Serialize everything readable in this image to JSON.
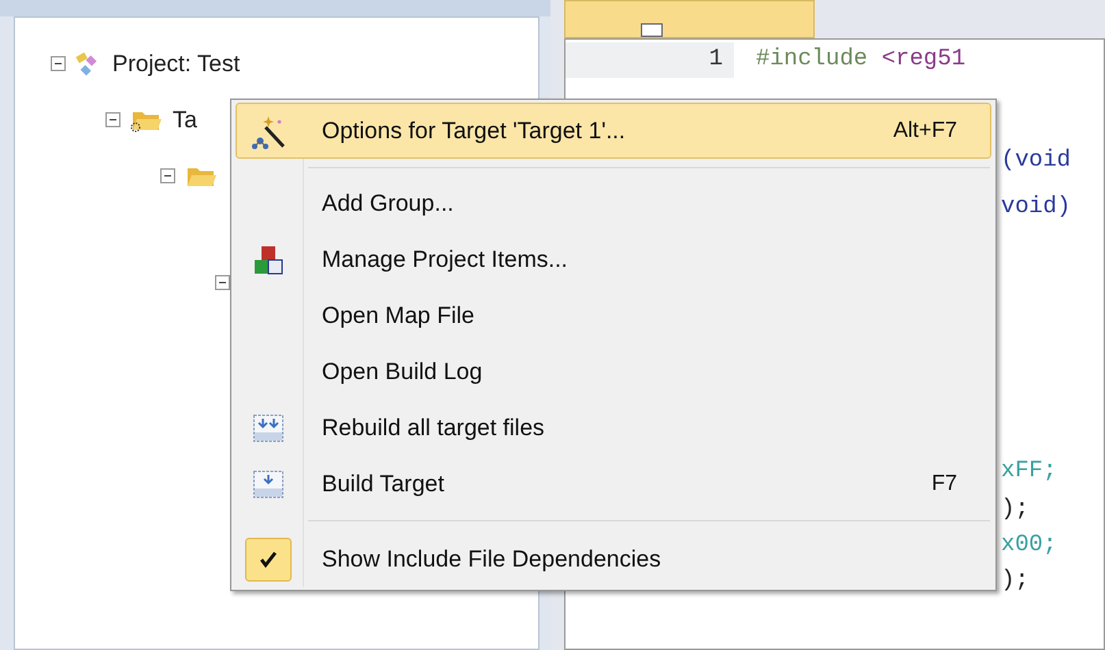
{
  "project_tree": [
    {
      "label": "Project: Test",
      "kind": "project",
      "expanded": true,
      "children": [
        {
          "label": "Ta",
          "kind": "target",
          "expanded": true,
          "children": [
            {
              "kind": "folder",
              "expanded": true,
              "children": [
                {
                  "expanded": true
                }
              ]
            }
          ]
        }
      ]
    }
  ],
  "editor": {
    "first_line": {
      "number": "1",
      "code": [
        {
          "text": "#include",
          "kind": "directive"
        },
        {
          "text": " <reg51",
          "kind": "header"
        }
      ]
    },
    "fragments": [
      {
        "text": "(void",
        "kind": "keyword"
      },
      {
        "text": "void)",
        "kind": "keyword"
      },
      {
        "text": "xFF;",
        "kind": "number"
      },
      {
        "text": ");",
        "kind": "plain"
      },
      {
        "text": "x00;",
        "kind": "number"
      },
      {
        "text": ");",
        "kind": "plain"
      }
    ]
  },
  "context_menu": [
    {
      "kind": "item",
      "label": "Options for Target 'Target 1'...",
      "shortcut": "Alt+F7",
      "highlighted": true,
      "checked": false
    },
    {
      "kind": "separator"
    },
    {
      "kind": "item",
      "label": "Add Group...",
      "highlighted": false,
      "checked": false
    },
    {
      "kind": "item",
      "label": "Manage Project Items...",
      "highlighted": false,
      "checked": false
    },
    {
      "kind": "item",
      "label": "Open Map File",
      "highlighted": false,
      "checked": false
    },
    {
      "kind": "item",
      "label": "Open Build Log",
      "highlighted": false,
      "checked": false
    },
    {
      "kind": "item",
      "label": "Rebuild all target files",
      "highlighted": false,
      "checked": false
    },
    {
      "kind": "item",
      "label": "Build Target",
      "shortcut": "F7",
      "highlighted": false,
      "checked": false
    },
    {
      "kind": "separator"
    },
    {
      "kind": "item",
      "label": "Show Include File Dependencies",
      "highlighted": false,
      "checked": true
    }
  ]
}
